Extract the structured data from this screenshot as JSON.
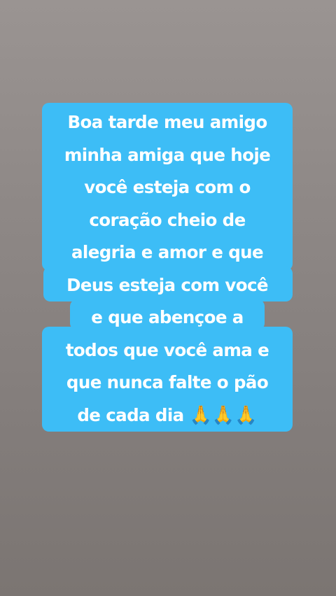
{
  "story": {
    "lines": [
      "Boa tarde meu amigo",
      "minha amiga que hoje",
      "você esteja com o",
      "coração cheio de",
      "alegria e amor e que",
      "Deus esteja com você",
      "e que abençoe a",
      "todos que você ama e",
      "que nunca falte o pão",
      "de cada dia"
    ],
    "emoji": "🙏🙏🙏"
  },
  "colors": {
    "background": "#8e8886",
    "highlight": "#3dbdf6",
    "text": "#ffffff"
  }
}
